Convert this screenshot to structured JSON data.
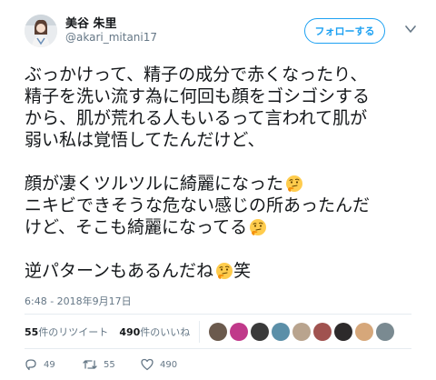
{
  "user": {
    "display_name": "美谷 朱里",
    "handle": "@akari_mitani17",
    "follow_label": "フォローする"
  },
  "tweet": {
    "lines": [
      {
        "text": "ぶっかけって、精子の成分で赤くなったり、",
        "emoji": ""
      },
      {
        "text": "精子を洗い流す為に何回も顔をゴシゴシする",
        "emoji": ""
      },
      {
        "text": "から、肌が荒れる人もいるって言われて肌が",
        "emoji": ""
      },
      {
        "text": "弱い私は覚悟してたんだけど、",
        "emoji": ""
      },
      {
        "text": "",
        "emoji": ""
      },
      {
        "text": "顔が凄くツルツルに綺麗になった",
        "emoji": "thinking-face-icon"
      },
      {
        "text": "ニキビできそうな危ない感じの所あったんだ",
        "emoji": ""
      },
      {
        "text": "けど、そこも綺麗になってる",
        "emoji": "thinking-face-icon"
      },
      {
        "text": "",
        "emoji": ""
      },
      {
        "text": "逆パターンもあるんだね",
        "emoji": "thinking-face-icon",
        "suffix": "笑"
      }
    ],
    "timestamp": "6:48 - 2018年9月17日"
  },
  "stats": {
    "retweets_count": "55",
    "retweets_label": "件のリツイート",
    "likes_count": "490",
    "likes_label": " 件のいいね"
  },
  "likers": [
    {
      "color": "#6b5a4d"
    },
    {
      "color": "#c0398a"
    },
    {
      "color": "#3a3a3a"
    },
    {
      "color": "#5b8fa8"
    },
    {
      "color": "#b9a48e"
    },
    {
      "color": "#a0524f"
    },
    {
      "color": "#2d2a2b"
    },
    {
      "color": "#d6a77a"
    },
    {
      "color": "#7a8a91"
    }
  ],
  "actions": {
    "reply_count": "49",
    "retweet_count": "55",
    "like_count": "490"
  },
  "colors": {
    "accent": "#1da1f2",
    "text": "#14171a",
    "muted": "#657786",
    "emoji": "#ffcc4d"
  }
}
